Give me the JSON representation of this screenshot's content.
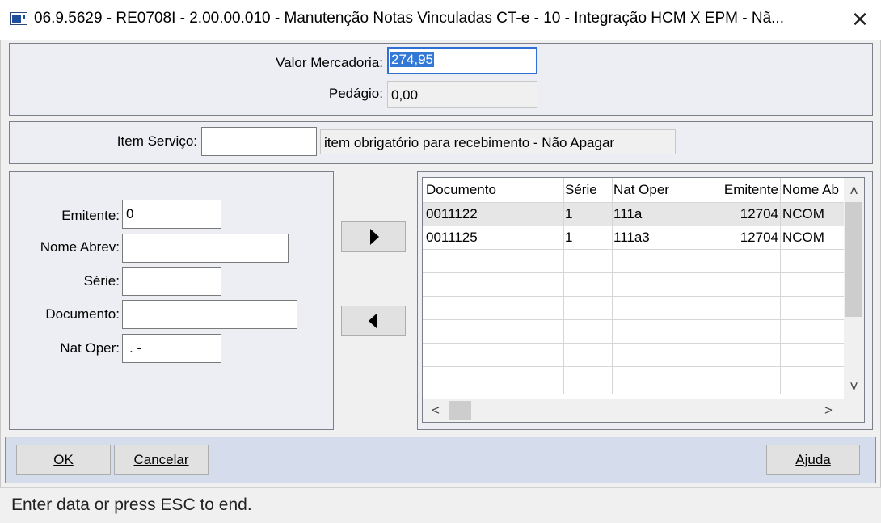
{
  "window": {
    "title": "06.9.5629 - RE0708I - 2.00.00.010 - Manutenção Notas Vinculadas CT-e - 10 - Integração HCM X EPM - Nã...",
    "close_glyph": "✕"
  },
  "values_panel": {
    "valor_mercadoria_label": "Valor Mercadoria:",
    "valor_mercadoria_value": "274,95",
    "pedagio_label": "Pedágio:",
    "pedagio_value": "0,00"
  },
  "item_panel": {
    "item_servico_label": "Item Serviço:",
    "item_servico_value": "",
    "item_description": "item obrigatório para recebimento - Não Apagar"
  },
  "filter_panel": {
    "emitente_label": "Emitente:",
    "emitente_value": "0",
    "nome_abrev_label": "Nome Abrev:",
    "nome_abrev_value": "",
    "serie_label": "Série:",
    "serie_value": "",
    "documento_label": "Documento:",
    "documento_value": "",
    "nat_oper_label": "Nat Oper:",
    "nat_oper_value": ". -"
  },
  "transfer_buttons": {
    "add_icon": "right-triangle-icon",
    "remove_icon": "left-triangle-icon"
  },
  "grid": {
    "columns": [
      "Documento",
      "Série",
      "Nat Oper",
      "Emitente",
      "Nome Ab"
    ],
    "rows": [
      {
        "documento": "0011122",
        "serie": "1",
        "nat_oper": "111a",
        "emitente": "12704",
        "nome_abrev": "NCOM"
      },
      {
        "documento": "0011125",
        "serie": "1",
        "nat_oper": "111a3",
        "emitente": "12704",
        "nome_abrev": "NCOM"
      }
    ],
    "scroll_up": "˄",
    "scroll_down": "˅",
    "scroll_left": "<",
    "scroll_right": ">"
  },
  "footer": {
    "ok_label": "OK",
    "cancel_label": "Cancelar",
    "help_label": "Ajuda"
  },
  "status": {
    "text": "Enter data or press ESC to end."
  },
  "colors": {
    "selection": "#3478d6",
    "footer_bg": "#d5dcec",
    "row_selected": "#e6e6e6"
  }
}
